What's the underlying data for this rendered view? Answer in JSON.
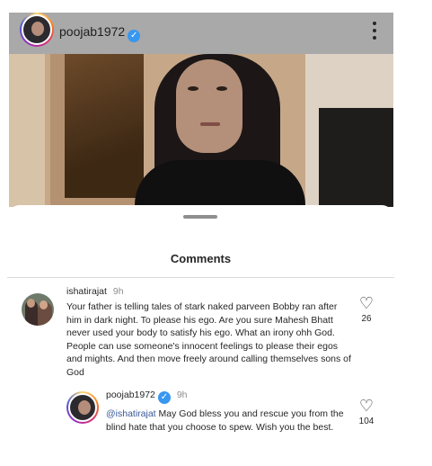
{
  "post": {
    "username": "poojab1972",
    "verified_glyph": "✓"
  },
  "sheet": {
    "title": "Comments"
  },
  "comments": [
    {
      "username": "ishatirajat",
      "time": "9h",
      "text": "Your father is telling tales of stark naked parveen Bobby ran after him in dark night. To please his ego. Are you sure Mahesh Bhatt never used your body to satisfy his ego. What an irony ohh God. People can use someone's innocent feelings to please their egos and mights. And then move freely around calling themselves sons of God",
      "likes": "26"
    }
  ],
  "reply": {
    "username": "poojab1972",
    "verified_glyph": "✓",
    "time": "9h",
    "mention": "@ishatirajat",
    "text": " May God bless you and rescue you from the blind hate that you choose to spew. Wish you the best.",
    "likes": "104"
  },
  "icons": {
    "heart": "♡"
  },
  "colors": {
    "verified": "#3897f0",
    "mention": "#385898",
    "header_bg": "#a9a9a9"
  }
}
